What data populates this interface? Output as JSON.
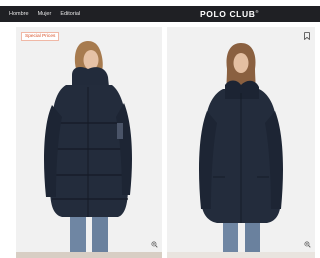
{
  "header": {
    "nav": [
      {
        "label": "Hombre"
      },
      {
        "label": "Mujer"
      },
      {
        "label": "Editorial"
      }
    ],
    "brand": "POLO CLUB",
    "brand_mark": "®"
  },
  "products": [
    {
      "badge": "Special Prices",
      "zoom_icon": "zoom-in-icon"
    },
    {
      "bookmark_icon": "bookmark-icon",
      "zoom_icon": "zoom-in-icon"
    }
  ],
  "colors": {
    "navbar": "#1f2024",
    "badge_text": "#d8542b",
    "jacket": "#222b3b"
  }
}
